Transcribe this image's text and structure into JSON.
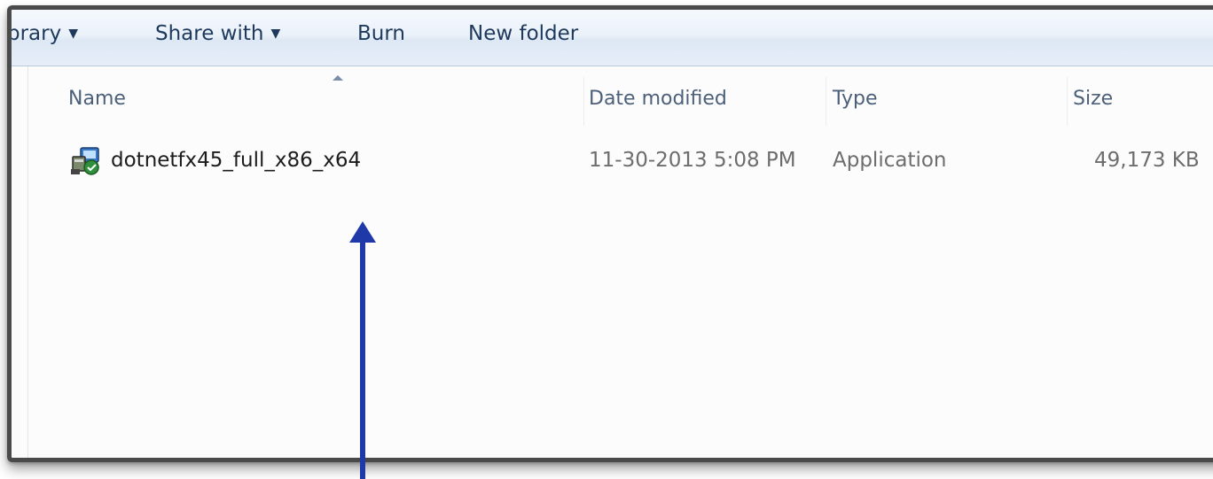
{
  "toolbar": {
    "library_label": "brary",
    "share_label": "Share with",
    "burn_label": "Burn",
    "new_folder_label": "New folder"
  },
  "columns": {
    "name": "Name",
    "date": "Date modified",
    "type": "Type",
    "size": "Size"
  },
  "files": [
    {
      "name": "dotnetfx45_full_x86_x64",
      "date": "11-30-2013 5:08 PM",
      "type": "Application",
      "size": "49,173 KB",
      "icon": "installer-app-icon"
    }
  ],
  "colors": {
    "toolbar_text": "#1e395b",
    "header_text": "#4c607a",
    "annotation_arrow": "#1f3aa8"
  }
}
